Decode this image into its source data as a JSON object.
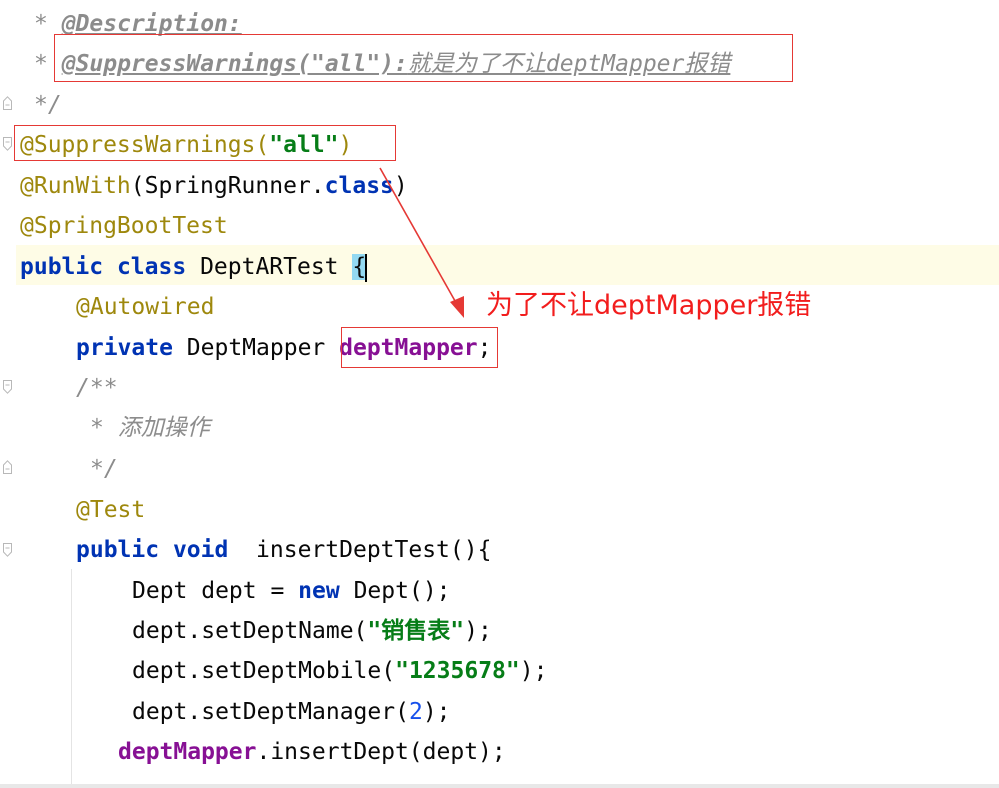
{
  "editor": {
    "lines": [
      {
        "star": "*",
        "tag": "@Description:"
      },
      {
        "star": "*",
        "tag": "@SuppressWarnings(\"all\"):",
        "text": "就是为了不让deptMapper报错"
      },
      {
        "text": "*/"
      },
      {
        "ann": "@SuppressWarnings(",
        "str": "\"all\"",
        "close": ")"
      },
      {
        "ann": "@RunWith",
        "p1": "(SpringRunner.",
        "kw": "class",
        "p2": ")"
      },
      {
        "ann": "@SpringBootTest"
      },
      {
        "kw1": "public",
        "kw2": "class",
        "name": "DeptARTest",
        "brace": "{"
      },
      {
        "ann": "@Autowired"
      },
      {
        "kw": "private",
        "type": "DeptMapper",
        "field": "deptMapper",
        "semi": ";"
      },
      {
        "text": "/**"
      },
      {
        "star": "*",
        "text": "添加操作"
      },
      {
        "text": "*/"
      },
      {
        "ann": "@Test"
      },
      {
        "kw1": "public",
        "kw2": "void",
        "name": "insertDeptTest(){"
      },
      {
        "p1": "Dept dept = ",
        "kw": "new",
        "p2": "Dept();"
      },
      {
        "p1": "dept.setDeptName(",
        "str": "\"销售表\"",
        "p2": ");"
      },
      {
        "p1": "dept.setDeptMobile(",
        "str": "\"1235678\"",
        "p2": ");"
      },
      {
        "p1": "dept.setDeptManager(",
        "num": "2",
        "p2": ");"
      },
      {
        "field": "deptMapper",
        "p1": ".insertDept(dept);"
      }
    ]
  },
  "callout": {
    "text": "为了不让deptMapper报错",
    "color": "#f21d1d"
  },
  "colors": {
    "keyword": "#0033b3",
    "annotation": "#9e880d",
    "string": "#067d17",
    "field": "#871094",
    "comment": "#8c8c8c",
    "number": "#1750eb",
    "highlight": "#e53935"
  }
}
